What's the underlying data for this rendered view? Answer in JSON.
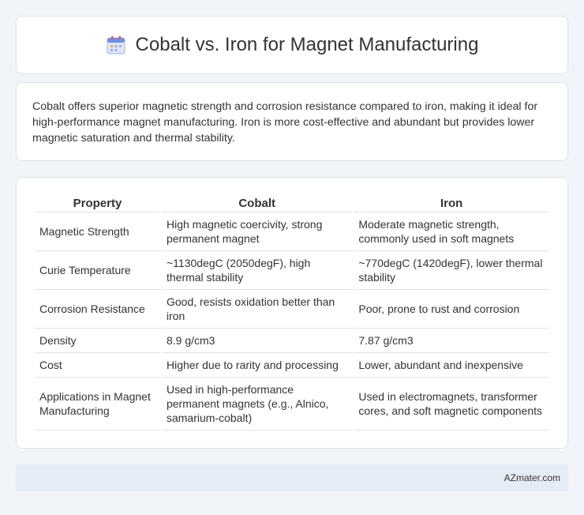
{
  "header": {
    "title": "Cobalt vs. Iron for Magnet Manufacturing",
    "icon": "calendar-icon"
  },
  "summary": "Cobalt offers superior magnetic strength and corrosion resistance compared to iron, making it ideal for high-performance magnet manufacturing. Iron is more cost-effective and abundant but provides lower magnetic saturation and thermal stability.",
  "table": {
    "headers": [
      "Property",
      "Cobalt",
      "Iron"
    ],
    "rows": [
      [
        "Magnetic Strength",
        "High magnetic coercivity, strong permanent magnet",
        "Moderate magnetic strength, commonly used in soft magnets"
      ],
      [
        "Curie Temperature",
        "~1130degC (2050degF), high thermal stability",
        "~770degC (1420degF), lower thermal stability"
      ],
      [
        "Corrosion Resistance",
        "Good, resists oxidation better than iron",
        "Poor, prone to rust and corrosion"
      ],
      [
        "Density",
        "8.9 g/cm3",
        "7.87 g/cm3"
      ],
      [
        "Cost",
        "Higher due to rarity and processing",
        "Lower, abundant and inexpensive"
      ],
      [
        "Applications in Magnet Manufacturing",
        "Used in high-performance permanent magnets (e.g., Alnico, samarium-cobalt)",
        "Used in electromagnets, transformer cores, and soft magnetic components"
      ]
    ]
  },
  "footer": {
    "brand": "AZmater.com"
  }
}
